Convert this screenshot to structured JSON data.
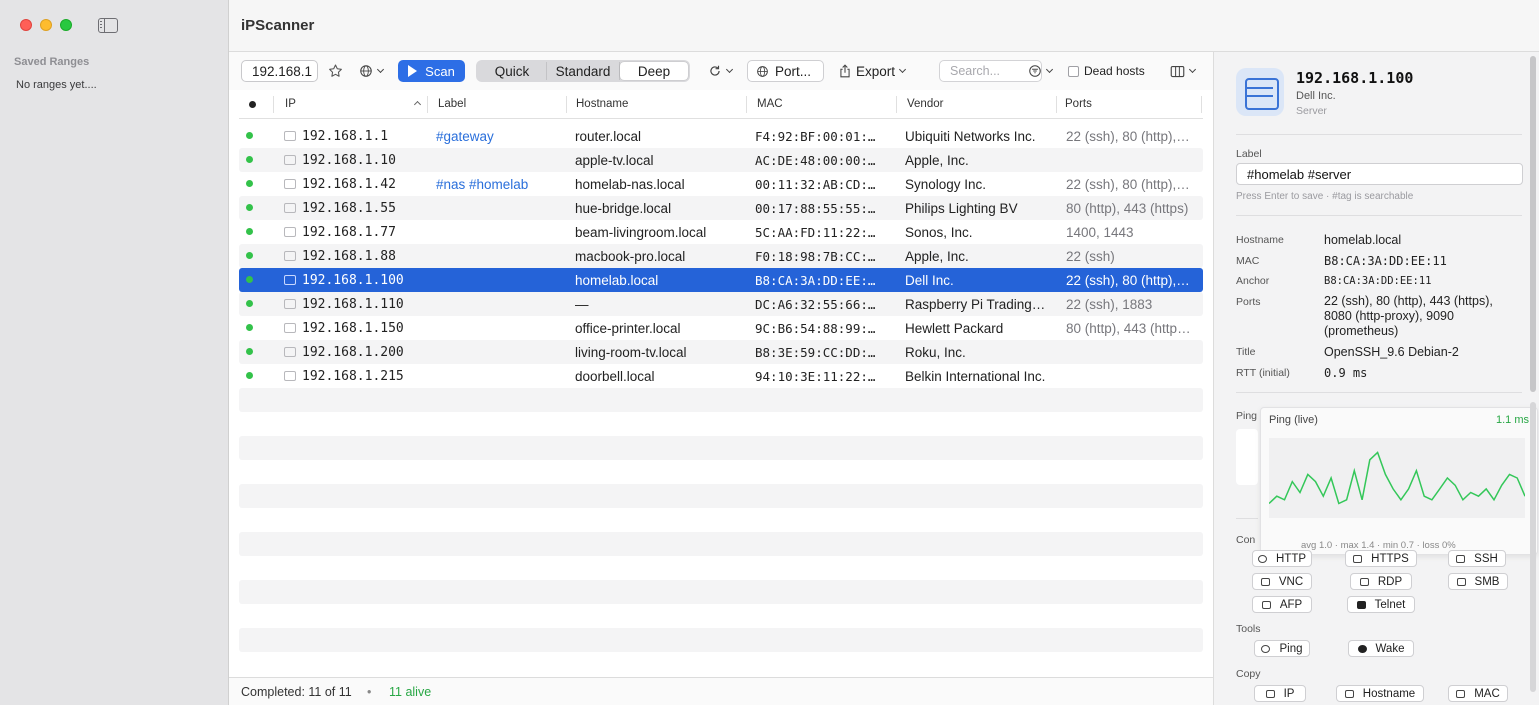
{
  "app": {
    "title": "iPScanner"
  },
  "sidebar": {
    "heading": "Saved Ranges",
    "empty_text": "No ranges yet...."
  },
  "toolbar": {
    "range_value": "192.168.1",
    "scan_label": "Scan",
    "modes": [
      "Quick",
      "Standard",
      "Deep"
    ],
    "active_mode": "Deep",
    "ports_label": "Port...",
    "export_label": "Export",
    "search_placeholder": "Search...",
    "dead_hosts_label": "Dead hosts",
    "dead_hosts_checked": false,
    "accent_color": "#2d6ee6"
  },
  "table": {
    "columns": [
      "IP",
      "Label",
      "Hostname",
      "MAC",
      "Vendor",
      "Ports"
    ],
    "sort_column": "IP",
    "rows": [
      {
        "ip": "192.168.1.1",
        "label": "#gateway",
        "hostname": "router.local",
        "mac": "F4:92:BF:00:01:…",
        "vendor": "Ubiquiti Networks Inc.",
        "ports": "22 (ssh), 80 (http),…",
        "icon": "router-icon"
      },
      {
        "ip": "192.168.1.10",
        "label": "",
        "hostname": "apple-tv.local",
        "mac": "AC:DE:48:00:00:…",
        "vendor": "Apple, Inc.",
        "ports": "",
        "icon": "tv-icon"
      },
      {
        "ip": "192.168.1.42",
        "label": "#nas #homelab",
        "hostname": "homelab-nas.local",
        "mac": "00:11:32:AB:CD:…",
        "vendor": "Synology Inc.",
        "ports": "22 (ssh), 80 (http),…",
        "icon": "nas-icon"
      },
      {
        "ip": "192.168.1.55",
        "label": "",
        "hostname": "hue-bridge.local",
        "mac": "00:17:88:55:55:…",
        "vendor": "Philips Lighting BV",
        "ports": "80 (http), 443 (https)",
        "icon": "server-icon"
      },
      {
        "ip": "192.168.1.77",
        "label": "",
        "hostname": "beam-livingroom.local",
        "mac": "5C:AA:FD:11:22:…",
        "vendor": "Sonos, Inc.",
        "ports": "1400, 1443",
        "icon": "speaker-icon"
      },
      {
        "ip": "192.168.1.88",
        "label": "",
        "hostname": "macbook-pro.local",
        "mac": "F0:18:98:7B:CC:…",
        "vendor": "Apple, Inc.",
        "ports": "22 (ssh)",
        "icon": "laptop-icon"
      },
      {
        "ip": "192.168.1.100",
        "label": "",
        "hostname": "homelab.local",
        "mac": "B8:CA:3A:DD:EE:…",
        "vendor": "Dell Inc.",
        "ports": "22 (ssh), 80 (http),…",
        "icon": "server-icon",
        "selected": true
      },
      {
        "ip": "192.168.1.110",
        "label": "",
        "hostname": "—",
        "mac": "DC:A6:32:55:66:…",
        "vendor": "Raspberry Pi Trading…",
        "ports": "22 (ssh), 1883",
        "icon": "server-icon"
      },
      {
        "ip": "192.168.1.150",
        "label": "",
        "hostname": "office-printer.local",
        "mac": "9C:B6:54:88:99:…",
        "vendor": "Hewlett Packard",
        "ports": "80 (http), 443 (http…",
        "icon": "printer-icon"
      },
      {
        "ip": "192.168.1.200",
        "label": "",
        "hostname": "living-room-tv.local",
        "mac": "B8:3E:59:CC:DD:…",
        "vendor": "Roku, Inc.",
        "ports": "",
        "icon": "tv-icon"
      },
      {
        "ip": "192.168.1.215",
        "label": "",
        "hostname": "doorbell.local",
        "mac": "94:10:3E:11:22:…",
        "vendor": "Belkin International Inc.",
        "ports": "",
        "icon": "doorbell-icon"
      }
    ]
  },
  "status": {
    "completed": "Completed: 11 of 11",
    "separator": "•",
    "alive": "11 alive"
  },
  "detail": {
    "ip": "192.168.1.100",
    "vendor": "Dell Inc.",
    "type": "Server",
    "label_heading": "Label",
    "label_value": "#homelab #server",
    "label_hint": "Press Enter to save · #tag is searchable",
    "fields": [
      {
        "key": "Hostname",
        "value": "homelab.local"
      },
      {
        "key": "MAC",
        "value": "B8:CA:3A:DD:EE:11"
      },
      {
        "key": "Anchor",
        "value": "B8:CA:3A:DD:EE:11"
      },
      {
        "key": "Ports",
        "value": "22 (ssh), 80 (http), 443 (https), 8080 (http-proxy), 9090 (prometheus)"
      },
      {
        "key": "Title",
        "value": "OpenSSH_9.6 Debian-2"
      },
      {
        "key": "RTT (initial)",
        "value": "0.9 ms"
      }
    ],
    "ping_section": "Ping",
    "connect_section": "Con",
    "ping_card": {
      "title": "Ping (live)",
      "current": "1.1 ms",
      "stats": "avg 1.0  ·  max 1.4  ·  min 0.7  ·  loss 0%"
    },
    "connect_buttons": [
      "HTTP",
      "HTTPS",
      "SSH",
      "VNC",
      "RDP",
      "SMB",
      "AFP",
      "Telnet"
    ],
    "tools_heading": "Tools",
    "tools_buttons": [
      "Ping",
      "Wake"
    ],
    "copy_heading": "Copy",
    "copy_buttons": [
      "IP",
      "Hostname",
      "MAC"
    ]
  },
  "chart_data": {
    "type": "line",
    "title": "Ping (live)",
    "series": [
      {
        "name": "",
        "values": [
          0.7,
          0.8,
          0.75,
          1.0,
          0.85,
          1.1,
          1.0,
          0.8,
          1.05,
          0.7,
          0.75,
          1.15,
          0.75,
          1.3,
          1.4,
          1.1,
          0.9,
          0.75,
          0.9,
          1.15,
          0.8,
          0.75,
          0.9,
          1.05,
          0.95,
          0.75,
          0.85,
          0.8,
          0.9,
          0.75,
          0.95,
          1.1,
          1.05,
          0.8
        ]
      }
    ],
    "line_color": "#34c759"
  }
}
